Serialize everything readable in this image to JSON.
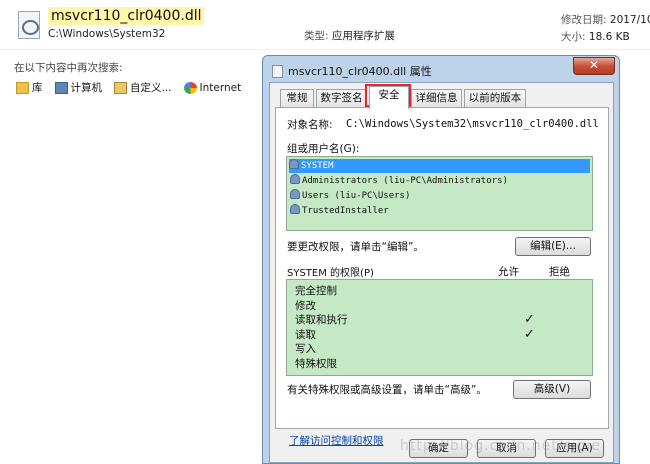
{
  "file": {
    "name": "msvcr110_clr0400.dll",
    "path": "C:\\Windows\\System32",
    "type_label": "类型:",
    "type_value": "应用程序扩展",
    "date_label": "修改日期:",
    "date_value": "2017/10/",
    "size_label": "大小:",
    "size_value": "18.6 KB"
  },
  "search": {
    "label": "在以下内容中再次搜索:",
    "locations": [
      "库",
      "计算机",
      "自定义...",
      "Internet"
    ]
  },
  "dialog": {
    "title": "msvcr110_clr0400.dll 属性",
    "close_symbol": "✕",
    "tabs": [
      "常规",
      "数字签名",
      "安全",
      "详细信息",
      "以前的版本"
    ],
    "active_tab": "安全",
    "object_label": "对象名称:",
    "object_value": "C:\\Windows\\System32\\msvcr110_clr0400.dll",
    "groups_label": "组或用户名(G):",
    "users": [
      "SYSTEM",
      "Administrators (liu-PC\\Administrators)",
      "Users (liu-PC\\Users)",
      "TrustedInstaller"
    ],
    "selected_user": "SYSTEM",
    "edit_hint": "要更改权限，请单击“编辑”。",
    "edit_button": "编辑(E)...",
    "perm_header": "SYSTEM 的权限(P)",
    "allow_label": "允许",
    "deny_label": "拒绝",
    "permissions": [
      {
        "name": "完全控制",
        "allow": false
      },
      {
        "name": "修改",
        "allow": false
      },
      {
        "name": "读取和执行",
        "allow": true
      },
      {
        "name": "读取",
        "allow": true
      },
      {
        "name": "写入",
        "allow": false
      },
      {
        "name": "特殊权限",
        "allow": false
      }
    ],
    "check_symbol": "✓",
    "advanced_hint": "有关特殊权限或高级设置，请单击“高级”。",
    "advanced_button": "高级(V)",
    "link": "了解访问控制和权限",
    "ok_button": "确定",
    "cancel_button": "取消",
    "apply_button": "应用(A)"
  },
  "annotation_color": "#e22a2a",
  "selection_color": "#3399ff",
  "list_bg_color": "#c4e9c4"
}
